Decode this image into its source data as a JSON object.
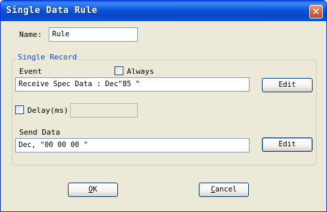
{
  "window": {
    "title": "Single Data Rule",
    "close_symbol": "✕"
  },
  "name_field": {
    "label": "Name:",
    "value": "Rule"
  },
  "group": {
    "title": "Single Record"
  },
  "event": {
    "label": "Event",
    "always_label": "Always",
    "always_checked": false,
    "value": "Receive Spec Data : Dec\"85 \"",
    "edit_label": "Edit"
  },
  "delay": {
    "label": "Delay(ms)",
    "checked": false,
    "value": ""
  },
  "send": {
    "label": "Send Data",
    "value": "Dec, \"00 00 00 \"",
    "edit_label": "Edit"
  },
  "buttons": {
    "ok_mnemonic": "O",
    "ok_rest": "K",
    "cancel_mnemonic": "C",
    "cancel_rest": "ancel"
  },
  "grip_glyph": "⋰"
}
